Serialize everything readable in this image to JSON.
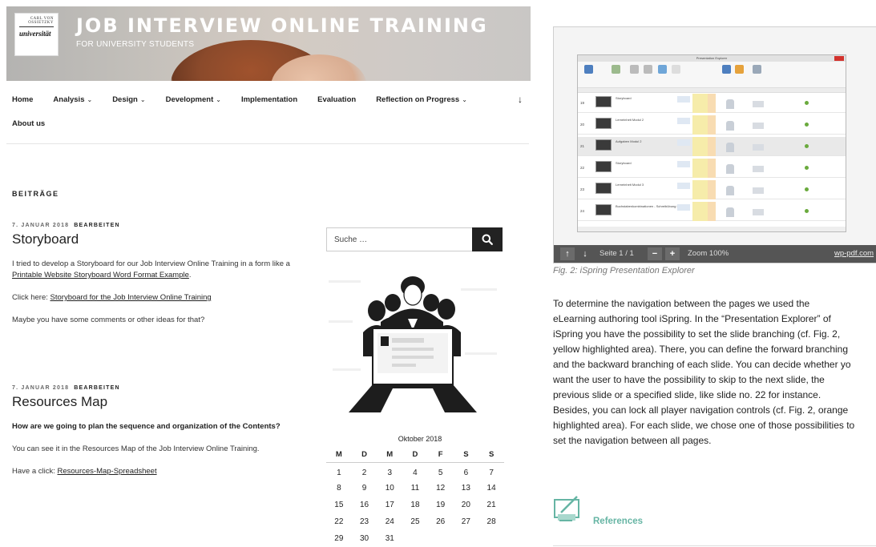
{
  "site": {
    "logo_top": "CARL VON OSSIETZKY",
    "logo_bottom": "universität",
    "title": "JOB INTERVIEW ONLINE TRAINING",
    "description": "FOR UNIVERSITY STUDENTS"
  },
  "nav": {
    "items": [
      {
        "label": "Home"
      },
      {
        "label": "Analysis",
        "dropdown": true
      },
      {
        "label": "Design",
        "dropdown": true
      },
      {
        "label": "Development",
        "dropdown": true
      },
      {
        "label": "Implementation"
      },
      {
        "label": "Evaluation"
      },
      {
        "label": "Reflection on Progress",
        "dropdown": true
      }
    ],
    "second_row": "About us",
    "scroll_icon": "arrow-down-icon"
  },
  "section_title": "BEITRÄGE",
  "posts": [
    {
      "date": "7. JANUAR 2018",
      "edit": "BEARBEITEN",
      "title": "Storyboard",
      "p1_pre": "I tried to develop a Storyboard for our Job Interview Online Training in a form like a ",
      "p1_link": "Printable Website Storyboard Word Format Example",
      "p1_post": ".",
      "p2_pre": "Click here:  ",
      "p2_link": "Storyboard for the Job Interview Online Training",
      "p3": "Maybe you have some comments or other ideas for that?"
    },
    {
      "date": "7. JANUAR 2018",
      "edit": "BEARBEITEN",
      "title": "Resources Map",
      "p1": "How are we going to plan the sequence and organization of the Contents?",
      "p2": "You can see it in the Resources Map of the Job Interview Online Training.",
      "p3_pre": "Have a click: ",
      "p3_link": " Resources-Map-Spreadsheet"
    }
  ],
  "search": {
    "placeholder": "Suche …",
    "icon": "search-icon"
  },
  "calendar": {
    "caption": "Oktober 2018",
    "weekdays": [
      "M",
      "D",
      "M",
      "D",
      "F",
      "S",
      "S"
    ],
    "weeks": [
      [
        "1",
        "2",
        "3",
        "4",
        "5",
        "6",
        "7"
      ],
      [
        "8",
        "9",
        "10",
        "11",
        "12",
        "13",
        "14"
      ],
      [
        "15",
        "16",
        "17",
        "18",
        "19",
        "20",
        "21"
      ],
      [
        "22",
        "23",
        "24",
        "25",
        "26",
        "27",
        "28"
      ],
      [
        "29",
        "30",
        "31",
        "",
        "",
        "",
        ""
      ]
    ]
  },
  "viewer": {
    "window_title": "Presentation Explorer",
    "page": "Seite 1 / 1",
    "zoom": "Zoom 100%",
    "brand": "wp-pdf.com",
    "rows": [
      "19",
      "20",
      "21",
      "22",
      "23",
      "24"
    ],
    "row_titles": [
      "Storyboard",
      "Lerneinheit Modul 2",
      "Aufgaben Modul 2",
      "Storyboard",
      "Lerneinheit Modul 3",
      "Buchstabenkombinationen - Schreibübung I"
    ]
  },
  "caption": "Fig. 2: iSpring Presentation Explorer",
  "article": "To determine the navigation between the pages we used the\neLearning authoring tool iSpring. In the “Presentation Explorer” of\niSpring you have the possibility to set the slide branching (cf. Fig. 2,\nyellow highlighted area). There, you can define the forward branching\nand the backward branching of each slide. You can decide whether yo\nwant the user to have the possibility to skip to the next slide, the\nprevious slide or a specified slide, like slide no. 22 for instance.\n Besides, you can lock all player navigation controls (cf. Fig. 2, orange\nhighlighted area). For each slide, we chose one of those possibilities to\nset the navigation between all pages.",
  "references": {
    "title": "References",
    "icon": "presentation-icon",
    "color": "#66b5a4"
  }
}
